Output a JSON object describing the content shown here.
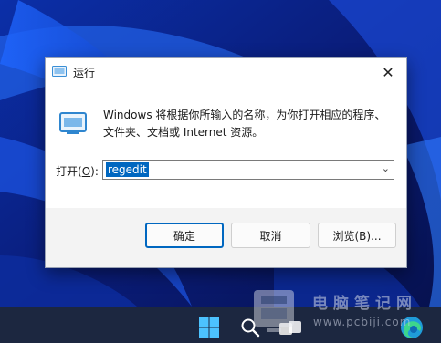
{
  "dialog": {
    "title": "运行",
    "description": "Windows 将根据你所输入的名称，为你打开相应的程序、文件夹、文档或 Internet 资源。",
    "open_label": "打开",
    "open_accel": "O",
    "open_suffix": "):",
    "open_value": "regedit",
    "ok_label": "确定",
    "cancel_label": "取消",
    "browse_label": "浏览(B)...",
    "close_symbol": "✕"
  },
  "watermark": {
    "text": "电脑笔记网",
    "url": "www.pcbiji.com"
  },
  "icons": [
    "run-icon",
    "close-icon",
    "chevron-down-icon",
    "windows-start-icon",
    "search-icon",
    "task-view-icon",
    "edge-icon"
  ],
  "colors": {
    "accent": "#0067c0",
    "wallpaper": "#0a1a6e",
    "taskbar": "#1c2740"
  }
}
